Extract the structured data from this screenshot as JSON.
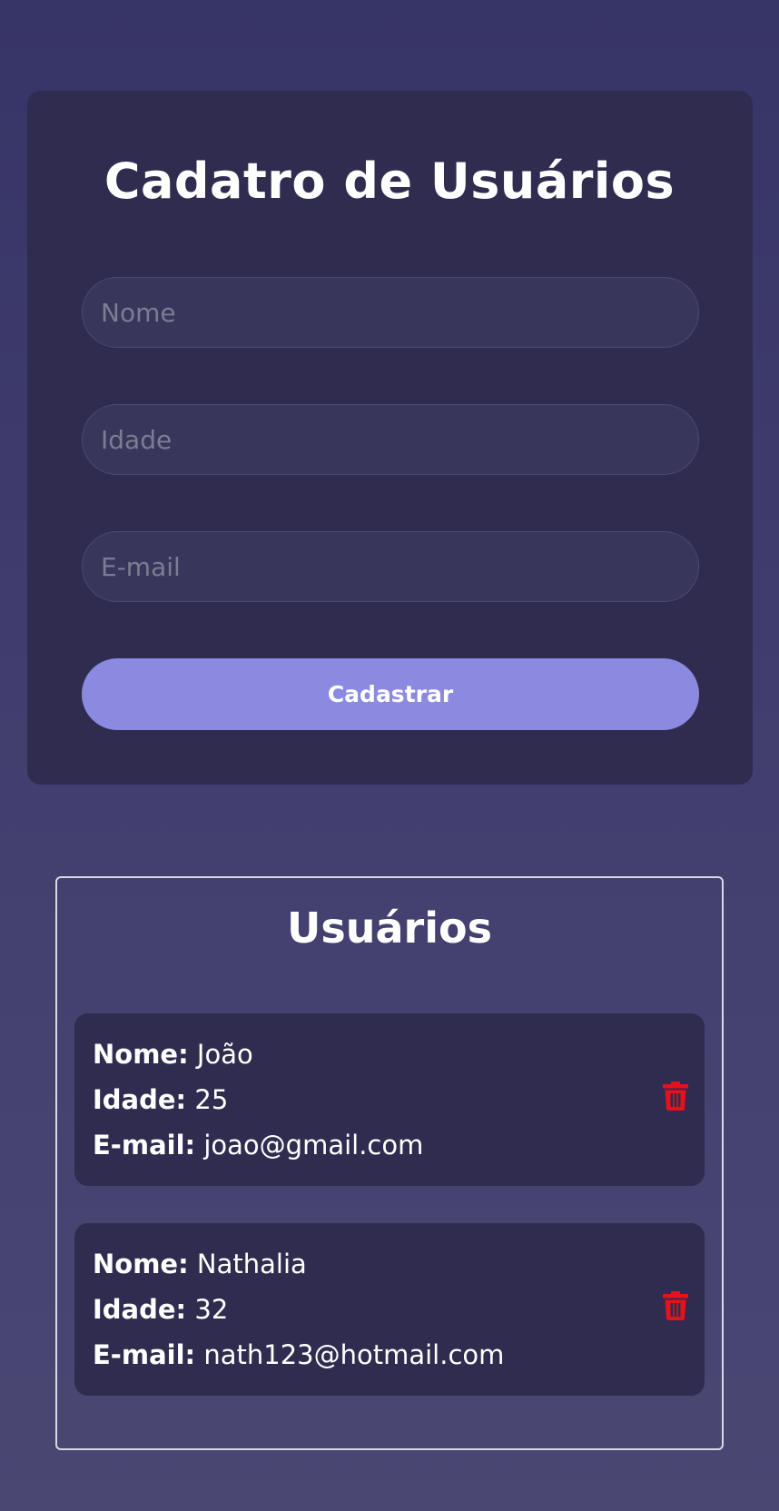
{
  "form": {
    "title": "Cadatro de Usuários",
    "name_placeholder": "Nome",
    "age_placeholder": "Idade",
    "email_placeholder": "E-mail",
    "submit_label": "Cadastrar"
  },
  "users_section": {
    "title": "Usuários",
    "label_name": "Nome:",
    "label_age": "Idade:",
    "label_email": "E-mail:",
    "delete_icon": "trash-icon",
    "delete_icon_color": "#e8101b",
    "users": [
      {
        "name": "João",
        "age": "25",
        "email": "joao@gmail.com"
      },
      {
        "name": "Nathalia",
        "age": "32",
        "email": "nath123@hotmail.com"
      }
    ]
  },
  "colors": {
    "accent": "#8b89e0",
    "card_background": "#2f2c4f",
    "page_background_top": "#373467",
    "page_background_bottom": "#4a4773"
  }
}
